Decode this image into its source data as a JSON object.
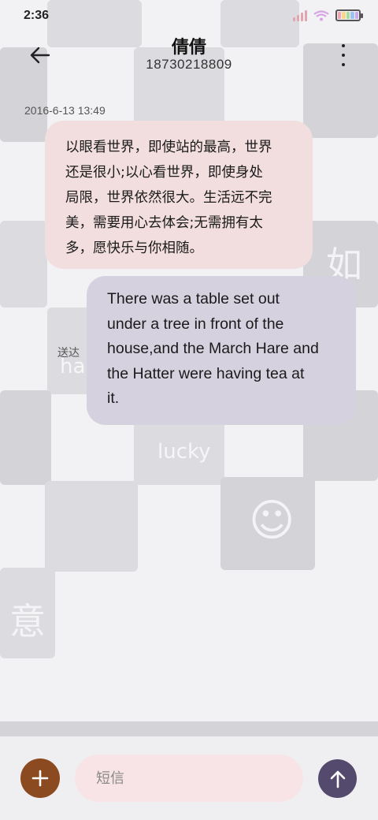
{
  "status_bar": {
    "time": "2:36",
    "signal_color": "#e0a6b0",
    "wifi_color": "#d6a4e2",
    "battery_colors": [
      "#f4a3b3",
      "#f8d78a",
      "#a8dba0",
      "#9cc4f0",
      "#c9a8ef"
    ]
  },
  "header": {
    "back_icon": "arrow-left-icon",
    "contact_name": "倩倩",
    "phone_number": "18730218809",
    "more_icon": "more-vertical-icon"
  },
  "conversation": {
    "timestamp": "2016-6-13 13:49",
    "incoming": {
      "lines": [
        "以眼看世界，即使站的最高，世界",
        "还是很小;以心看世界，即使身处",
        "局限，世界依然很大。生活远不完",
        "美，需要用心去体会;无需拥有太",
        "多，愿快乐与你相随。"
      ],
      "background": "#f2dede"
    },
    "outgoing": {
      "lines": [
        "There was a table set out",
        "under a tree in front of the",
        "house,and the March Hare and",
        "the Hatter were having tea at",
        "it."
      ],
      "background": "#d5d1df",
      "status": "送达"
    }
  },
  "wallpaper": {
    "glyph_ru": "如",
    "glyph_yi": "意",
    "word_lucky": "lucky",
    "word_ha": "ha",
    "smiley": "☺"
  },
  "composer": {
    "add_icon": "plus-icon",
    "add_color": "#8b4a1f",
    "placeholder": "短信",
    "value": "",
    "send_icon": "arrow-up-icon",
    "send_color": "#544a6e"
  }
}
